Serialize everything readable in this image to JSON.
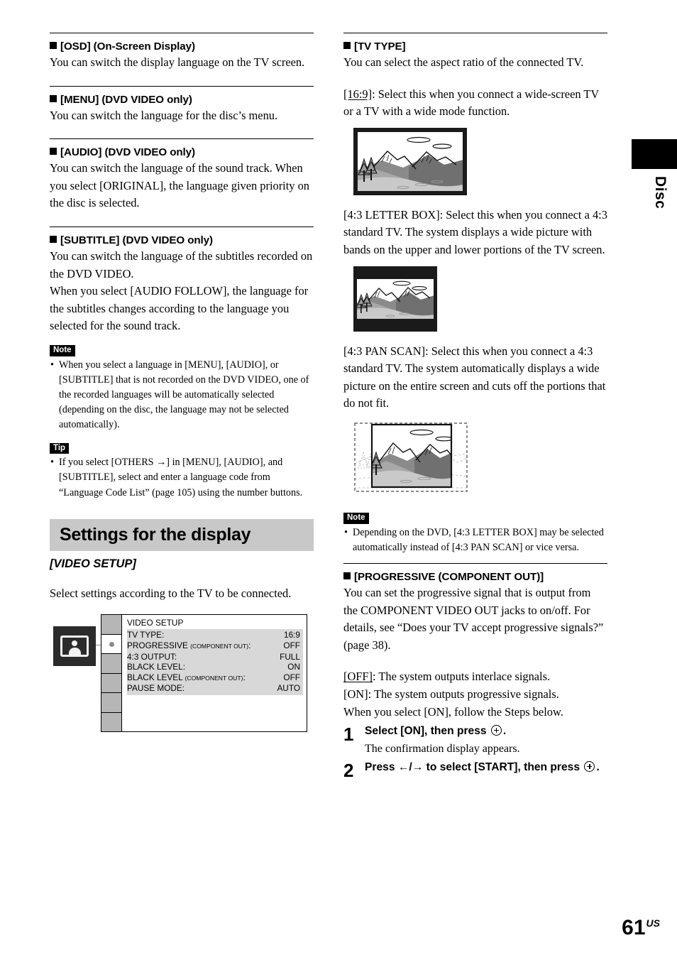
{
  "page": {
    "number": "61",
    "region": "US",
    "edge_tab_label": "Disc"
  },
  "left_column": {
    "sections": [
      {
        "heading": "[OSD] (On-Screen Display)",
        "paragraphs": [
          "You can switch the display language on the TV screen."
        ]
      },
      {
        "heading": "[MENU] (DVD VIDEO only)",
        "paragraphs": [
          "You can switch the language for the disc’s menu."
        ]
      },
      {
        "heading": "[AUDIO] (DVD VIDEO only)",
        "paragraphs": [
          "You can switch the language of the sound track. When you select [ORIGINAL], the language given priority on the disc is selected."
        ]
      },
      {
        "heading": "[SUBTITLE] (DVD VIDEO only)",
        "paragraphs": [
          "You can switch the language of the subtitles recorded on the DVD VIDEO.",
          "When you select [AUDIO FOLLOW], the language for the subtitles changes according to the language you selected for the sound track."
        ]
      }
    ],
    "note": {
      "tag": "Note",
      "items": [
        "When you select a language in [MENU], [AUDIO], or [SUBTITLE] that is not recorded on the DVD VIDEO, one of the recorded languages will be automatically selected (depending on the disc, the language may not be selected automatically)."
      ]
    },
    "tip": {
      "tag": "Tip",
      "items": [
        "If you select [OTHERS →] in [MENU], [AUDIO], and [SUBTITLE], select and enter a language code from “Language Code List” (page 105) using the number buttons."
      ]
    },
    "banner": "Settings for the display",
    "subhead": "[VIDEO SETUP]",
    "intro": "Select settings according to the TV to be connected.",
    "osd": {
      "icon_name": "video-setup-icon",
      "title": "VIDEO SETUP",
      "rows": [
        {
          "label": "TV TYPE:",
          "sub": "",
          "value": "16:9"
        },
        {
          "label": "PROGRESSIVE ",
          "sub": "(COMPONENT OUT)",
          "value": "OFF",
          "colon_after_sub": ":"
        },
        {
          "label": "4:3 OUTPUT:",
          "sub": "",
          "value": "FULL"
        },
        {
          "label": "BLACK LEVEL:",
          "sub": "",
          "value": "ON"
        },
        {
          "label": "BLACK LEVEL ",
          "sub": "(COMPONENT OUT)",
          "value": "OFF",
          "colon_after_sub": ":"
        },
        {
          "label": "PAUSE MODE:",
          "sub": "",
          "value": "AUTO"
        }
      ],
      "sidebar_cells": 6,
      "selected_cell_index": 1
    }
  },
  "right_column": {
    "tv_type": {
      "heading": "[TV TYPE]",
      "intro": "You can select the aspect ratio of the connected TV.",
      "options": [
        {
          "label": "[16:9]",
          "underlined": true,
          "text": ": Select this when you connect a wide-screen TV or a TV with a wide mode function.",
          "figure_name": "wide-16-9-illustration"
        },
        {
          "label": "[4:3 LETTER BOX]",
          "underlined": false,
          "text": ": Select this when you connect a 4:3 standard TV. The system displays a wide picture with bands on the upper and lower portions of the TV screen.",
          "figure_name": "letterbox-4-3-illustration"
        },
        {
          "label": "[4:3 PAN SCAN]",
          "underlined": false,
          "text": ": Select this when you connect a 4:3 standard TV. The system automatically displays a wide picture on the entire screen and cuts off the portions that do not fit.",
          "figure_name": "panscan-4-3-illustration"
        }
      ]
    },
    "note": {
      "tag": "Note",
      "items": [
        "Depending on the DVD, [4:3 LETTER BOX] may be selected automatically instead of [4:3 PAN SCAN] or vice versa."
      ]
    },
    "progressive": {
      "heading": "[PROGRESSIVE (COMPONENT OUT)]",
      "intro": "You can set the progressive signal that is output from the COMPONENT VIDEO OUT jacks to on/off. For details, see “Does your TV accept progressive signals?” (page 38).",
      "off_label": "[OFF]",
      "off_text": ": The system outputs interlace signals.",
      "on_label": "[ON]",
      "on_text": ": The system outputs progressive signals.",
      "follow_text": "When you select [ON], follow the Steps below.",
      "steps": [
        {
          "num": "1",
          "text_before": "Select [ON], then press",
          "icon": "enter-button-icon",
          "text_after": ".",
          "sub": "The confirmation display appears."
        },
        {
          "num": "2",
          "text_before": "Press ←/→ to select [START], then press",
          "icon": "enter-button-icon",
          "text_after": ".",
          "sub": ""
        }
      ]
    }
  }
}
